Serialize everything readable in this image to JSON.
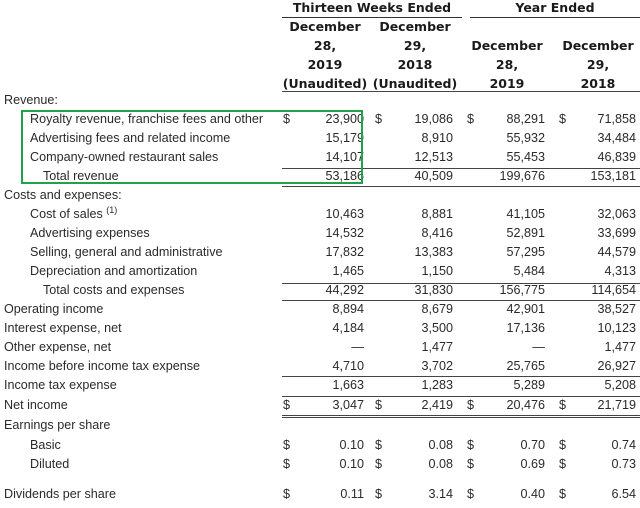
{
  "header": {
    "group1": "Thirteen Weeks Ended",
    "group2": "Year Ended",
    "cols": [
      [
        "December",
        "28,",
        "2019",
        "(Unaudited)"
      ],
      [
        "December",
        "29,",
        "2018",
        "(Unaudited)"
      ],
      [
        "December",
        "28,",
        "2019"
      ],
      [
        "December",
        "29,",
        "2018"
      ]
    ]
  },
  "rows": [
    {
      "label": "Revenue:",
      "indent": 0,
      "values": []
    },
    {
      "label": "Royalty revenue, franchise fees and other",
      "indent": 2,
      "dollar": true,
      "values": [
        "23,900",
        "19,086",
        "88,291",
        "71,858"
      ]
    },
    {
      "label": "Advertising fees and related income",
      "indent": 2,
      "values": [
        "15,179",
        "8,910",
        "55,932",
        "34,484"
      ]
    },
    {
      "label": "Company-owned restaurant sales",
      "indent": 2,
      "values": [
        "14,107",
        "12,513",
        "55,453",
        "46,839"
      ]
    },
    {
      "label": "Total revenue",
      "indent": 3,
      "values": [
        "53,186",
        "40,509",
        "199,676",
        "153,181"
      ]
    },
    {
      "label": "Costs and expenses:",
      "indent": 0,
      "values": []
    },
    {
      "label": "Cost of sales",
      "sup": "(1)",
      "indent": 2,
      "values": [
        "10,463",
        "8,881",
        "41,105",
        "32,063"
      ]
    },
    {
      "label": "Advertising expenses",
      "indent": 2,
      "values": [
        "14,532",
        "8,416",
        "52,891",
        "33,699"
      ]
    },
    {
      "label": "Selling, general and administrative",
      "indent": 2,
      "values": [
        "17,832",
        "13,383",
        "57,295",
        "44,579"
      ]
    },
    {
      "label": "Depreciation and amortization",
      "indent": 2,
      "values": [
        "1,465",
        "1,150",
        "5,484",
        "4,313"
      ]
    },
    {
      "label": "Total costs and expenses",
      "indent": 3,
      "values": [
        "44,292",
        "31,830",
        "156,775",
        "114,654"
      ]
    },
    {
      "label": "Operating income",
      "indent": 0,
      "values": [
        "8,894",
        "8,679",
        "42,901",
        "38,527"
      ]
    },
    {
      "label": "Interest expense, net",
      "indent": 0,
      "values": [
        "4,184",
        "3,500",
        "17,136",
        "10,123"
      ]
    },
    {
      "label": "Other expense, net",
      "indent": 0,
      "values": [
        "—",
        "1,477",
        "—",
        "1,477"
      ]
    },
    {
      "label": "Income before income tax expense",
      "indent": 0,
      "values": [
        "4,710",
        "3,702",
        "25,765",
        "26,927"
      ]
    },
    {
      "label": "Income tax expense",
      "indent": 0,
      "values": [
        "1,663",
        "1,283",
        "5,289",
        "5,208"
      ]
    },
    {
      "label": "Net income",
      "indent": 0,
      "dollar": true,
      "values": [
        "3,047",
        "2,419",
        "20,476",
        "21,719"
      ]
    },
    {
      "label": "Earnings per share",
      "indent": 0,
      "values": []
    },
    {
      "label": "Basic",
      "indent": 2,
      "dollar": true,
      "values": [
        "0.10",
        "0.08",
        "0.70",
        "0.74"
      ]
    },
    {
      "label": "Diluted",
      "indent": 2,
      "dollar": true,
      "values": [
        "0.10",
        "0.08",
        "0.69",
        "0.73"
      ]
    },
    {
      "label": "Dividends per share",
      "indent": 0,
      "dollar": true,
      "values": [
        "0.11",
        "3.14",
        "0.40",
        "6.54"
      ]
    }
  ],
  "dollar_sign": "$",
  "highlight_color": "#22a14a"
}
